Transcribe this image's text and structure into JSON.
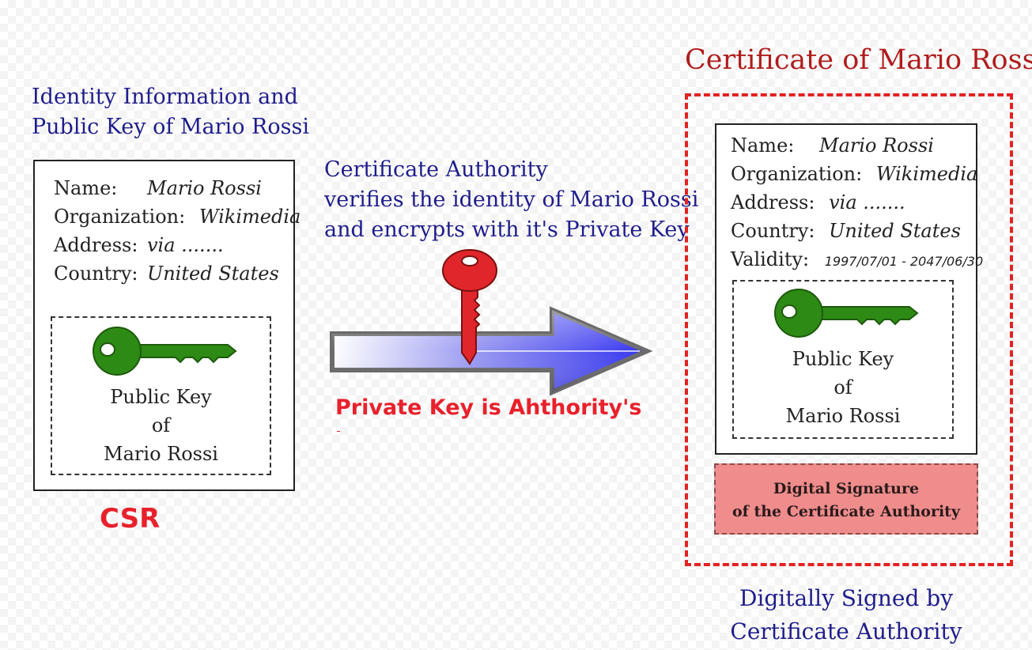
{
  "csr": {
    "caption_line1": "Identity Information and",
    "caption_line2": "Public Key of Mario Rossi",
    "fields": [
      {
        "label": "Name:",
        "value": "Mario Rossi"
      },
      {
        "label": "Organization:",
        "value": "Wikimedia"
      },
      {
        "label": "Address:",
        "value": "via ......."
      },
      {
        "label": "Country:",
        "value": "United States"
      }
    ],
    "public_key_lines": [
      "Public Key",
      "of",
      "Mario Rossi"
    ],
    "badge": "CSR",
    "key_icon": "green-key-icon",
    "key_color": "#2d8a14"
  },
  "authority": {
    "line1": "Certificate Authority",
    "line2": "verifies the identity of Mario Rossi",
    "line3": "and encrypts with it's Private Key",
    "private_key_note": "Private Key is Ahthority's",
    "key_icon": "red-key-icon",
    "key_color": "#e0262b",
    "arrow_icon": "arrow-right-icon",
    "arrow_color": "#3b3bf5"
  },
  "certificate": {
    "title": "Certificate of Mario Rossi",
    "fields": [
      {
        "label": "Name:",
        "value": "Mario Rossi"
      },
      {
        "label": "Organization:",
        "value": "Wikimedia"
      },
      {
        "label": "Address:",
        "value": "via ......."
      },
      {
        "label": "Country:",
        "value": "United States"
      },
      {
        "label": "Validity:",
        "value": "1997/07/01 - 2047/06/30"
      }
    ],
    "public_key_lines": [
      "Public Key",
      "of",
      "Mario Rossi"
    ],
    "signature_line1": "Digital Signature",
    "signature_line2": "of the Certificate Authority",
    "footer_line1": "Digitally Signed by",
    "footer_line2": "Certificate Authority",
    "border_color": "#e32221",
    "signature_color": "#ef8c8c",
    "key_icon": "green-key-icon"
  }
}
